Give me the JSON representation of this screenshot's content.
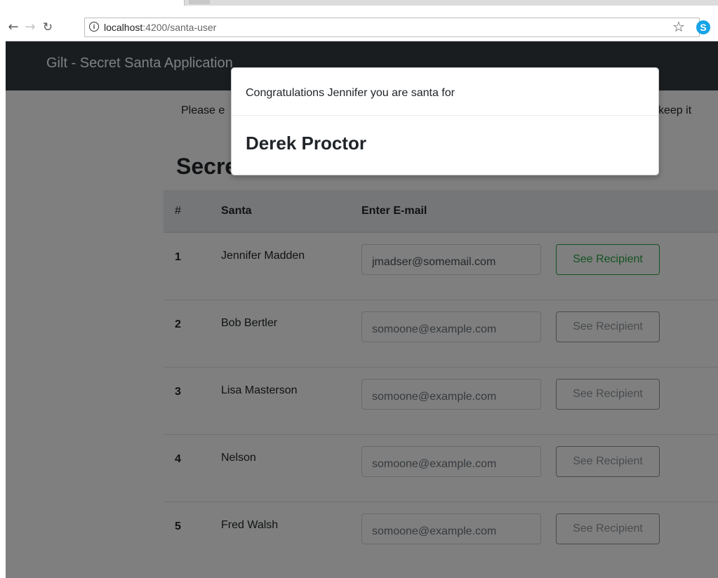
{
  "browser": {
    "url_host": "localhost",
    "url_path": ":4200/santa-user"
  },
  "navbar": {
    "brand": "Gilt - Secret Santa Application"
  },
  "intro": {
    "start": "Please e",
    "end": "keep it"
  },
  "heading": "Secret Santa List",
  "table": {
    "headers": {
      "num": "#",
      "santa": "Santa",
      "email": "Enter E-mail"
    },
    "rows": [
      {
        "num": "1",
        "santa": "Jennifer Madden",
        "email": "jmadser@somemail.com",
        "button": "See Recipient"
      },
      {
        "num": "2",
        "santa": "Bob Bertler",
        "email": "",
        "button": "See Recipient"
      },
      {
        "num": "3",
        "santa": "Lisa Masterson",
        "email": "",
        "button": "See Recipient"
      },
      {
        "num": "4",
        "santa": "Nelson",
        "email": "",
        "button": "See Recipient"
      },
      {
        "num": "5",
        "santa": "Fred Walsh",
        "email": "",
        "button": "See Recipient"
      }
    ],
    "email_placeholder": "somoone@example.com"
  },
  "modal": {
    "message": "Congratulations Jennifer you are santa for",
    "recipient": "Derek Proctor"
  },
  "colors": {
    "navbar": "#343a40",
    "success": "#28a745",
    "secondary": "#6c757d"
  }
}
